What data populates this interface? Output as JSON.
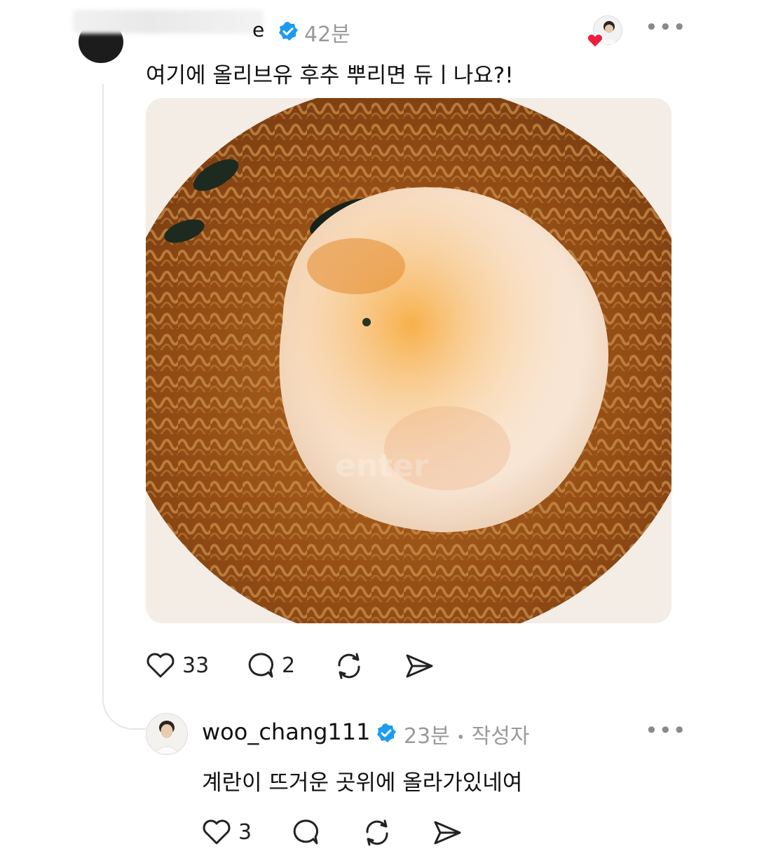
{
  "top_post": {
    "username_visible": "e",
    "time": "42분",
    "text": "여기에 올리브유 후추 뿌리면 듀ㅣ나요?!",
    "photo_watermark": "enter",
    "actions": {
      "likes": "33",
      "comments": "2"
    }
  },
  "reply": {
    "username": "woo_chang111",
    "time": "23분",
    "separator": "•",
    "author_badge": "작성자",
    "text": "계란이 뜨거운 곳위에 올라가있네여",
    "actions": {
      "likes": "3"
    }
  },
  "more_label": "•••",
  "colors": {
    "verified": "#1d9bf0",
    "heart": "#ed1d3b",
    "muted": "#9a9a9a"
  }
}
